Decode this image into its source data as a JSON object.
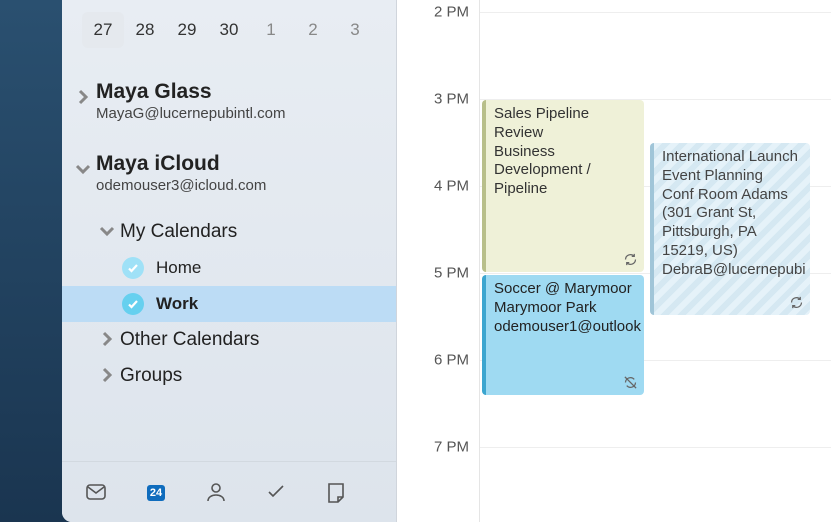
{
  "miniCalendar": {
    "days": [
      {
        "d": "27",
        "current": true
      },
      {
        "d": "28"
      },
      {
        "d": "29"
      },
      {
        "d": "30"
      },
      {
        "d": "1",
        "dim": true
      },
      {
        "d": "2",
        "dim": true
      },
      {
        "d": "3",
        "dim": true
      }
    ]
  },
  "accounts": [
    {
      "name": "Maya Glass",
      "email": "MayaG@lucernepubintl.com",
      "expanded": false
    },
    {
      "name": "Maya iCloud",
      "email": "odemouser3@icloud.com",
      "expanded": true
    }
  ],
  "calGroups": {
    "myCalendars": {
      "label": "My Calendars"
    },
    "other": {
      "label": "Other Calendars"
    },
    "groups": {
      "label": "Groups"
    }
  },
  "calendars": {
    "home": {
      "label": "Home",
      "color": "#8fd9f5"
    },
    "work": {
      "label": "Work",
      "color": "#66d0ef"
    }
  },
  "navCalendarBadge": "24",
  "timeLabels": [
    "2 PM",
    "3 PM",
    "4 PM",
    "5 PM",
    "6 PM",
    "7 PM"
  ],
  "events": {
    "sales": {
      "title": "Sales Pipeline Review",
      "sub1": "Business Development / Pipeline"
    },
    "soccer": {
      "title": "Soccer @ Marymoor",
      "loc": "Marymoor Park",
      "attendee": "odemouser1@outlook"
    },
    "launch": {
      "title": "International Launch Event Planning",
      "loc": "Conf Room Adams (301 Grant St, Pittsburgh, PA 15219, US)",
      "attendee": "DebraB@lucernepubi"
    }
  }
}
